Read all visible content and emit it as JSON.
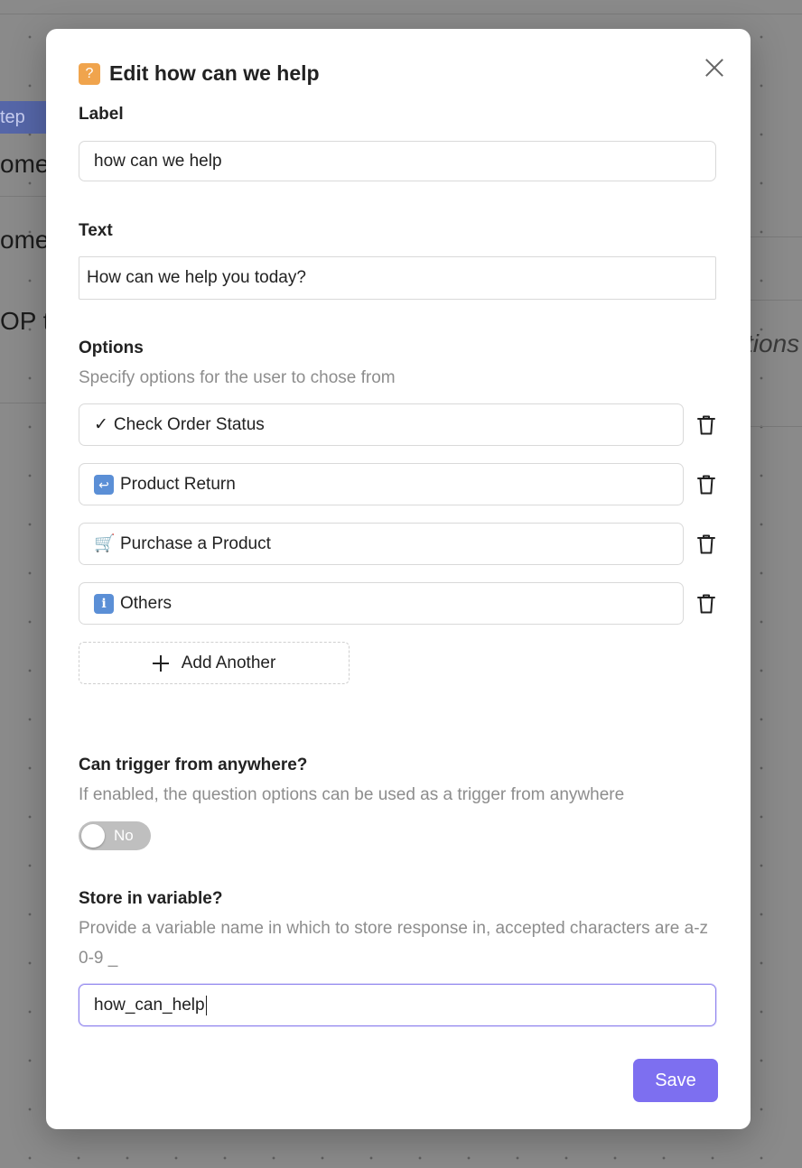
{
  "background": {
    "tag_text": "tep",
    "row1_text": "ome",
    "row2_text": "ome",
    "row3_text": "OP t",
    "side_text": "tions"
  },
  "modal": {
    "title_icon": "?",
    "title": "Edit how can we help",
    "label": {
      "heading": "Label",
      "value": "how can we help"
    },
    "text": {
      "heading": "Text",
      "value": "How can we help you today?"
    },
    "options": {
      "heading": "Options",
      "help": "Specify options for the user to chose from",
      "items": [
        {
          "emoji": "✓",
          "icon": "checkmark-icon",
          "label": "Check Order Status"
        },
        {
          "emoji": "↩",
          "icon": "return-arrow-icon",
          "label": "Product Return"
        },
        {
          "emoji": "🛒",
          "icon": "shopping-cart-icon",
          "label": "Purchase a Product"
        },
        {
          "emoji": "i",
          "icon": "info-icon",
          "label": "Others"
        }
      ],
      "add_label": "Add Another"
    },
    "trigger": {
      "heading": "Can trigger from anywhere?",
      "help": "If enabled, the question options can be used as a trigger from anywhere",
      "toggle_label": "No",
      "enabled": false
    },
    "variable": {
      "heading": "Store in variable?",
      "help": "Provide a variable name in which to store response in, accepted characters are a-z 0-9 _",
      "value": "how_can_help"
    },
    "save_label": "Save"
  },
  "colors": {
    "accent": "#7d6ff0",
    "title_icon_bg": "#f0a44d",
    "toggle_off": "#bfbfbf"
  }
}
